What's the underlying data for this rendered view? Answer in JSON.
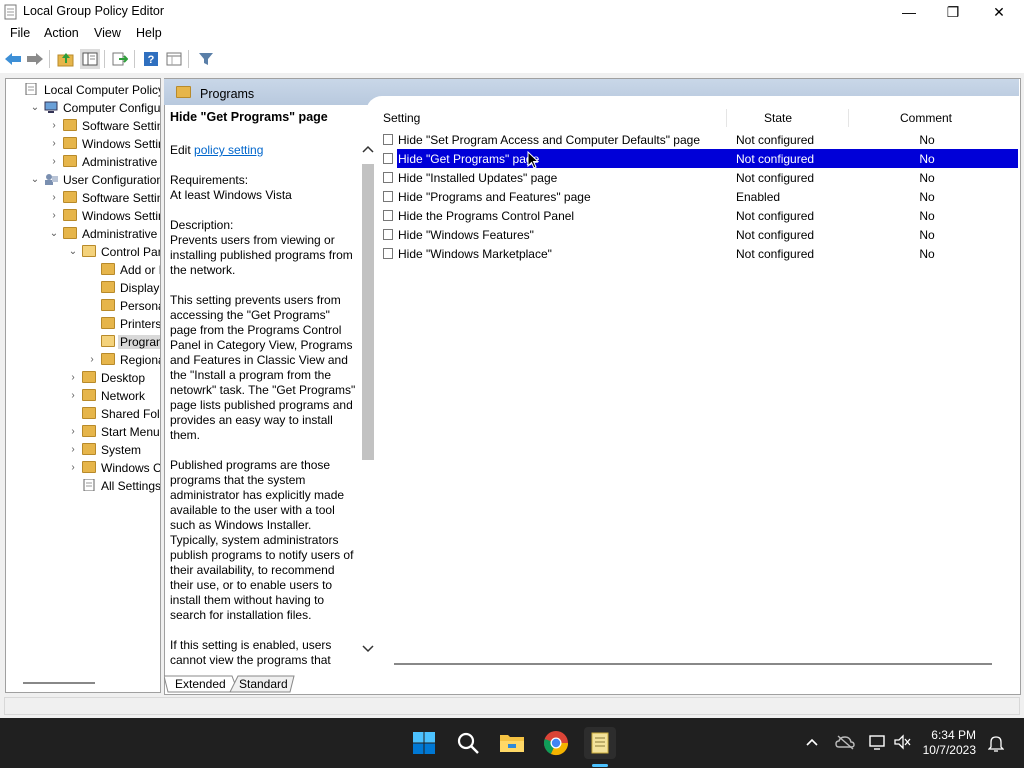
{
  "window": {
    "title": "Local Group Policy Editor",
    "controls": [
      "—",
      "❐",
      "✕"
    ]
  },
  "menu": [
    "File",
    "Action",
    "View",
    "Help"
  ],
  "tree": [
    {
      "label": "Local Computer Policy",
      "depth": 0,
      "toggle": "",
      "icon": "computer-policy-icon"
    },
    {
      "label": "Computer Configura",
      "depth": 1,
      "toggle": "⌄",
      "icon": "computer-icon"
    },
    {
      "label": "Software Settings",
      "depth": 2,
      "toggle": "›",
      "icon": "folder-icon"
    },
    {
      "label": "Windows Setting",
      "depth": 2,
      "toggle": "›",
      "icon": "folder-icon"
    },
    {
      "label": "Administrative Te",
      "depth": 2,
      "toggle": "›",
      "icon": "folder-icon"
    },
    {
      "label": "User Configuration",
      "depth": 1,
      "toggle": "⌄",
      "icon": "user-icon"
    },
    {
      "label": "Software Settings",
      "depth": 2,
      "toggle": "›",
      "icon": "folder-icon"
    },
    {
      "label": "Windows Setting",
      "depth": 2,
      "toggle": "›",
      "icon": "folder-icon"
    },
    {
      "label": "Administrative Te",
      "depth": 2,
      "toggle": "⌄",
      "icon": "folder-icon"
    },
    {
      "label": "Control Panel",
      "depth": 3,
      "toggle": "⌄",
      "icon": "folder-open-icon"
    },
    {
      "label": "Add or Re",
      "depth": 4,
      "toggle": "",
      "icon": "folder-icon"
    },
    {
      "label": "Display",
      "depth": 4,
      "toggle": "",
      "icon": "folder-icon"
    },
    {
      "label": "Personaliz",
      "depth": 4,
      "toggle": "",
      "icon": "folder-icon"
    },
    {
      "label": "Printers",
      "depth": 4,
      "toggle": "",
      "icon": "folder-icon"
    },
    {
      "label": "Programs",
      "depth": 4,
      "toggle": "",
      "icon": "folder-open-icon",
      "selected": true
    },
    {
      "label": "Regional a",
      "depth": 4,
      "toggle": "›",
      "icon": "folder-icon"
    },
    {
      "label": "Desktop",
      "depth": 3,
      "toggle": "›",
      "icon": "folder-icon"
    },
    {
      "label": "Network",
      "depth": 3,
      "toggle": "›",
      "icon": "folder-icon"
    },
    {
      "label": "Shared Folder",
      "depth": 3,
      "toggle": "",
      "icon": "folder-icon"
    },
    {
      "label": "Start Menu ar",
      "depth": 3,
      "toggle": "›",
      "icon": "folder-icon"
    },
    {
      "label": "System",
      "depth": 3,
      "toggle": "›",
      "icon": "folder-icon"
    },
    {
      "label": "Windows Cor",
      "depth": 3,
      "toggle": "›",
      "icon": "folder-icon"
    },
    {
      "label": "All Settings",
      "depth": 3,
      "toggle": "",
      "icon": "all-settings-icon"
    }
  ],
  "header": {
    "title": "Programs"
  },
  "description": {
    "title": "Hide \"Get Programs\" page",
    "edit_prefix": "Edit",
    "edit_link": "policy setting",
    "requirements_label": "Requirements:",
    "requirements_value": "At least Windows Vista",
    "description_label": "Description:",
    "para1": "Prevents users from viewing or installing published programs from the network.",
    "para2": "This setting prevents users from accessing the \"Get Programs\" page from the Programs Control Panel in Category View, Programs and Features in Classic View and the \"Install a program from the netowrk\" task.  The \"Get Programs\" page lists published programs and provides an easy way to install them.",
    "para3": "Published programs are those programs that the system administrator has explicitly made available to the user with a tool such as Windows Installer.  Typically, system administrators publish programs to notify users of their availability, to recommend their use, or to enable users to install them without having to search for installation files.",
    "para4": "If this setting is enabled, users cannot view the programs that"
  },
  "table": {
    "columns": [
      "Setting",
      "State",
      "Comment"
    ],
    "rows": [
      {
        "setting": "Hide \"Set Program Access and Computer Defaults\" page",
        "state": "Not configured",
        "comment": "No"
      },
      {
        "setting": "Hide \"Get Programs\" page",
        "state": "Not configured",
        "comment": "No",
        "selected": true
      },
      {
        "setting": "Hide \"Installed Updates\" page",
        "state": "Not configured",
        "comment": "No"
      },
      {
        "setting": "Hide \"Programs and Features\" page",
        "state": "Enabled",
        "comment": "No"
      },
      {
        "setting": "Hide the Programs Control Panel",
        "state": "Not configured",
        "comment": "No"
      },
      {
        "setting": "Hide \"Windows Features\"",
        "state": "Not configured",
        "comment": "No"
      },
      {
        "setting": "Hide \"Windows Marketplace\"",
        "state": "Not configured",
        "comment": "No"
      }
    ]
  },
  "tabs": [
    "Extended",
    "Standard"
  ],
  "clock": {
    "time": "6:34 PM",
    "date": "10/7/2023"
  },
  "colors": {
    "selection": "#0000d8",
    "link": "#0066cc",
    "taskbar": "#202020",
    "header": "#c9d7e8"
  }
}
